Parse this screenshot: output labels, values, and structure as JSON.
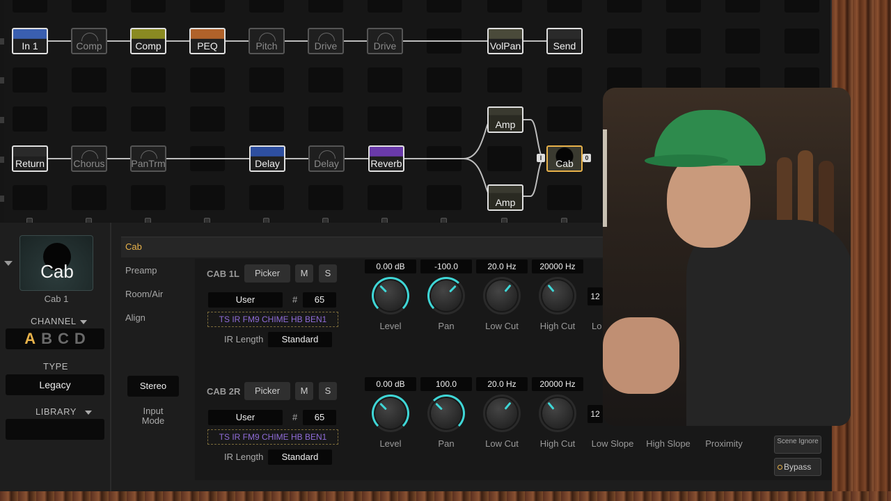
{
  "grid": {
    "row1": [
      {
        "label": "In 1",
        "style": "in"
      },
      {
        "label": "Comp",
        "style": "dim"
      },
      {
        "label": "Comp",
        "style": "comp"
      },
      {
        "label": "PEQ",
        "style": "peq"
      },
      {
        "label": "Pitch",
        "style": "dim"
      },
      {
        "label": "Drive",
        "style": "dim"
      },
      {
        "label": "Drive",
        "style": "dim"
      },
      {
        "label": "VolPan",
        "style": "volpan"
      },
      {
        "label": "Send",
        "style": "send"
      }
    ],
    "row2": [
      {
        "label": "Return",
        "style": "return"
      },
      {
        "label": "Chorus",
        "style": "dim"
      },
      {
        "label": "PanTrm",
        "style": "dim"
      },
      {
        "label": "Delay",
        "style": "delay"
      },
      {
        "label": "Delay",
        "style": "dim"
      },
      {
        "label": "Reverb",
        "style": "reverb"
      }
    ],
    "amp_top": "Amp",
    "amp_bottom": "Amp",
    "cab": "Cab",
    "cab_tag_left": "I",
    "cab_tag_right": "0"
  },
  "sidebar": {
    "tile_label": "Cab",
    "tile_sub": "Cab 1",
    "channel_label": "CHANNEL",
    "channels": [
      "A",
      "B",
      "C",
      "D"
    ],
    "active_channel": "A",
    "type_label": "TYPE",
    "type_value": "Legacy",
    "library_label": "LIBRARY",
    "library_value": ""
  },
  "menu": {
    "active": "Cab",
    "items": [
      "Preamp",
      "Room/Air",
      "Align"
    ],
    "input_mode_value": "Stereo",
    "input_mode_label": "Input Mode"
  },
  "cab1": {
    "name": "CAB 1L",
    "picker": "Picker",
    "m": "M",
    "s": "S",
    "source": "User",
    "hash": "#",
    "number": "65",
    "ir_name": "TS IR FM9 CHIME HB BEN1",
    "ir_length_label": "IR Length",
    "ir_length": "Standard",
    "level": "0.00 dB",
    "pan": "-100.0",
    "low_cut": "20.0 Hz",
    "high_cut": "20000 Hz",
    "extra_value": "12",
    "extra_label": "Lo"
  },
  "cab2": {
    "name": "CAB 2R",
    "picker": "Picker",
    "m": "M",
    "s": "S",
    "source": "User",
    "hash": "#",
    "number": "65",
    "ir_name": "TS IR FM9 CHIME HB BEN1",
    "ir_length_label": "IR Length",
    "ir_length": "Standard",
    "level": "0.00 dB",
    "pan": "100.0",
    "low_cut": "20.0 Hz",
    "high_cut": "20000 Hz",
    "extra_value": "12 d"
  },
  "knob_labels": {
    "level": "Level",
    "pan": "Pan",
    "low_cut": "Low Cut",
    "high_cut": "High Cut",
    "low_slope": "Low Slope",
    "high_slope": "High Slope",
    "proximity": "Proximity"
  },
  "controls": {
    "scene_ignore": "Scene Ignore",
    "bypass": "Bypass"
  },
  "colors": {
    "accent": "#e8b24a",
    "knob": "#3fd6d6",
    "ir_text": "#8f6cd8"
  }
}
